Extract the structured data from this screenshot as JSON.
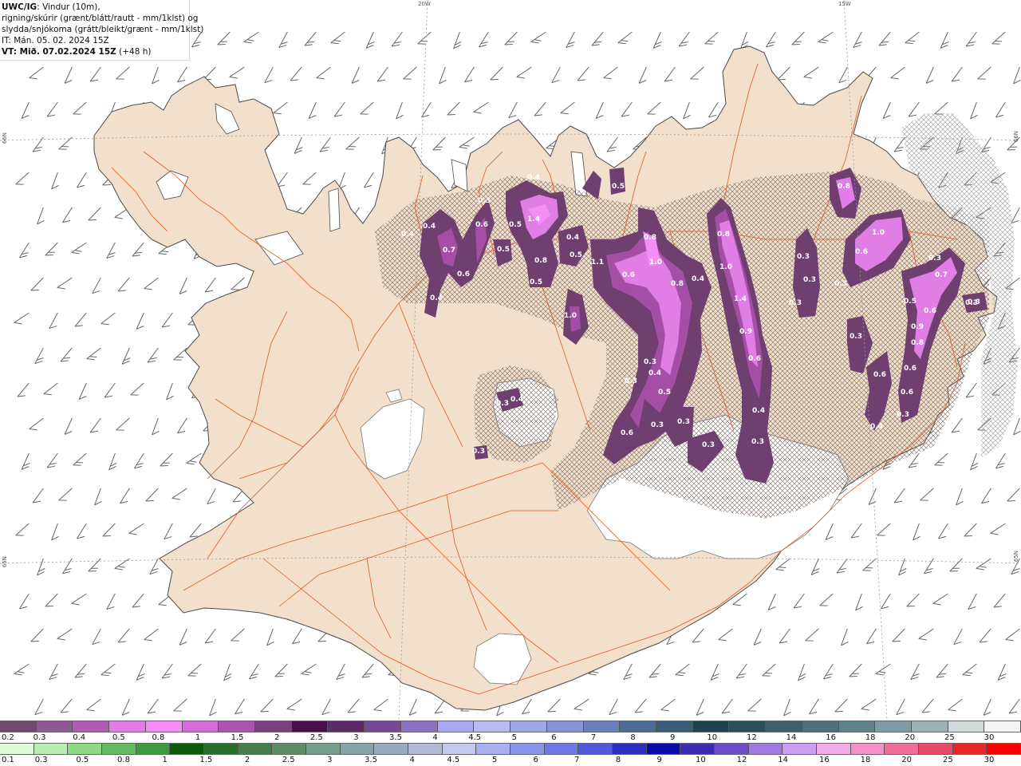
{
  "header": {
    "title_bold": "UWC/IG",
    "title_rest": ": Vindur (10m),",
    "line2": "rigning/skúrir (grænt/blátt/rautt - mm/1klst) og",
    "line3": "slydda/snjókoma (grátt/bleikt/grænt - mm/1klst)",
    "line4": "IT: Mán. 05. 02. 2024 15Z",
    "line5_bold": "VT: Mið. 07.02.2024 15Z",
    "line5_rest": " (+48 h)"
  },
  "grid_labels": {
    "lon_20w": "20W",
    "lon_15w": "15W",
    "lat_66n_left": "66N",
    "lat_66n_right": "66N",
    "lat_65n_left": "65N",
    "lat_65n_right": "65N"
  },
  "colors": {
    "sea": "#ffffff",
    "land": "#f2dfcc",
    "roads": "#e25a20",
    "precip_dark": "#6e3f6f",
    "precip_mid": "#a44ea6",
    "precip_light": "#e07ee5",
    "precip_bright": "#f28ef5",
    "wind_barb": "#666666",
    "hatch": "#7a6a5e"
  },
  "precip_values": [
    {
      "label": "0.4"
    },
    {
      "label": "0.7"
    },
    {
      "label": "0.6"
    },
    {
      "label": "0.4"
    },
    {
      "label": "0.4"
    },
    {
      "label": "0.6"
    },
    {
      "label": "0.3"
    },
    {
      "label": "1.4"
    },
    {
      "label": "0.5"
    },
    {
      "label": "0.4"
    },
    {
      "label": "0.5"
    },
    {
      "label": "0.5"
    },
    {
      "label": "0.8"
    },
    {
      "label": "0.5"
    },
    {
      "label": "1.0"
    },
    {
      "label": "0.4"
    },
    {
      "label": "0.5"
    },
    {
      "label": "1.1"
    },
    {
      "label": "0.6"
    },
    {
      "label": "0.8"
    },
    {
      "label": "1.0"
    },
    {
      "label": "0.8"
    },
    {
      "label": "0.4"
    },
    {
      "label": "0.8"
    },
    {
      "label": "1.0"
    },
    {
      "label": "1.4"
    },
    {
      "label": "0.9"
    },
    {
      "label": "0.6"
    },
    {
      "label": "0.4"
    },
    {
      "label": "0.3"
    },
    {
      "label": "0.3"
    },
    {
      "label": "0.8"
    },
    {
      "label": "1.0"
    },
    {
      "label": "0.6"
    },
    {
      "label": "0.3"
    },
    {
      "label": "0.3"
    },
    {
      "label": "0.7"
    },
    {
      "label": "0.5"
    },
    {
      "label": "0.6"
    },
    {
      "label": "0.3"
    },
    {
      "label": "0.9"
    },
    {
      "label": "0.8"
    },
    {
      "label": "0.3"
    },
    {
      "label": "0.6"
    },
    {
      "label": "0.6"
    },
    {
      "label": "0.6"
    },
    {
      "label": "0.3"
    },
    {
      "label": "0.4"
    },
    {
      "label": "0.3"
    },
    {
      "label": "0.4"
    },
    {
      "label": "0.5"
    },
    {
      "label": "0.3"
    },
    {
      "label": "0.3"
    },
    {
      "label": "0.6"
    },
    {
      "label": "0.3"
    },
    {
      "label": "0.3"
    },
    {
      "label": "0.3"
    },
    {
      "label": "0.4"
    },
    {
      "label": "0.3"
    },
    {
      "label": "0.3"
    },
    {
      "label": "0.3"
    },
    {
      "label": "0.3"
    }
  ],
  "legend_snow": {
    "colors": [
      "#6e4a6e",
      "#8e5a8f",
      "#b05cb3",
      "#e07ee5",
      "#f28ef5",
      "#d070d6",
      "#a955ad",
      "#7a3f7e",
      "#4a0e4c",
      "#5e2a68",
      "#744a94",
      "#8a72c0",
      "#a8a8ee",
      "#b8baf0",
      "#9ea6e4",
      "#8a92d6",
      "#6b7fba",
      "#4d6b94",
      "#375e74",
      "#1c4450",
      "#2c4e5a",
      "#3e6066",
      "#4e7076",
      "#5e8286",
      "#7f9ca4",
      "#9cb2b8",
      "#d4dadb",
      "#f4f4f4"
    ],
    "ticks": [
      "0.2",
      "0.3",
      "0.4",
      "0.5",
      "0.8",
      "1",
      "1.5",
      "2",
      "2.5",
      "3",
      "3.5",
      "4",
      "4.5",
      "5",
      "6",
      "7",
      "8",
      "9",
      "10",
      "12",
      "14",
      "16",
      "18",
      "20",
      "25",
      "30"
    ]
  },
  "legend_rain": {
    "colors": [
      "#dffad8",
      "#b8eeb0",
      "#8ed888",
      "#62ba62",
      "#3e9a40",
      "#0e5a0c",
      "#2a6e2c",
      "#447e4a",
      "#608a66",
      "#769c8a",
      "#84a2a8",
      "#98aabf",
      "#b2bad6",
      "#c6c8ee",
      "#a8b0f0",
      "#8a94ea",
      "#6e78e4",
      "#5258dc",
      "#2e2ebc",
      "#0a0aa8",
      "#3c2cb0",
      "#6e4ec8",
      "#a07ae0",
      "#cc9ef0",
      "#f0aee8",
      "#f690c8",
      "#ee6e98",
      "#e84a6a",
      "#e82828",
      "#ff0000"
    ],
    "ticks": [
      "0.1",
      "0.3",
      "0.5",
      "0.8",
      "1",
      "1.5",
      "2",
      "2.5",
      "3",
      "3.5",
      "4",
      "4.5",
      "5",
      "6",
      "7",
      "8",
      "9",
      "10",
      "12",
      "14",
      "16",
      "18",
      "20",
      "25",
      "30"
    ]
  }
}
